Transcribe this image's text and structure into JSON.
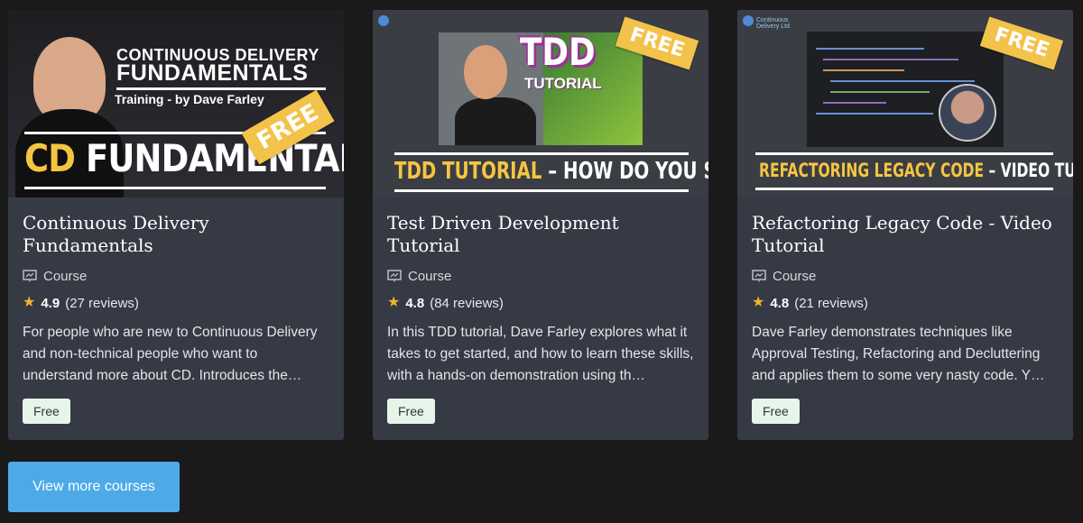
{
  "cards": [
    {
      "title": "Continuous Delivery Fundamentals",
      "type": "Course",
      "rating": "4.9",
      "reviews": "(27 reviews)",
      "description": "For people who are new to Continuous Delivery and non-technical people who want to understand more about CD. Introduces the…",
      "price": "Free",
      "thumb": {
        "headline1": "CONTINUOUS DELIVERY",
        "headline2": "FUNDAMENTALS",
        "subtitle": "Training - by Dave Farley",
        "big_cd": "CD",
        "big_rest": " FUNDAMENTALS",
        "free_tag": "FREE"
      }
    },
    {
      "title": "Test Driven Development Tutorial",
      "type": "Course",
      "rating": "4.8",
      "reviews": "(84 reviews)",
      "description": "In this TDD tutorial, Dave Farley explores what it takes to get started, and how to learn these skills, with a hands-on demonstration using th…",
      "price": "Free",
      "thumb": {
        "tdd": "TDD",
        "tutorial": "TUTORIAL",
        "caption_a": "TDD TUTORIAL",
        "caption_b": " – HOW DO YOU START",
        "free_tag": "FREE"
      }
    },
    {
      "title": "Refactoring Legacy Code - Video Tutorial",
      "type": "Course",
      "rating": "4.8",
      "reviews": "(21 reviews)",
      "description": "Dave Farley demonstrates techniques like Approval Testing, Refactoring and Decluttering and applies them to some very nasty code. Y…",
      "price": "Free",
      "thumb": {
        "caption_a": "REFACTORING LEGACY CODE",
        "caption_b": " – VIDEO TUTORIAL",
        "free_tag": "FREE",
        "logo_text": "Continuous Delivery Ltd"
      }
    }
  ],
  "view_more": "View more courses",
  "colors": {
    "accent": "#4daae6",
    "card": "#353a44",
    "background": "#1a1a1a",
    "star": "#f3b32c",
    "free_tag": "#f3c24a",
    "badge": "#e7f4ea"
  },
  "icons": {
    "type": "presentation-icon",
    "rating": "star-icon"
  }
}
